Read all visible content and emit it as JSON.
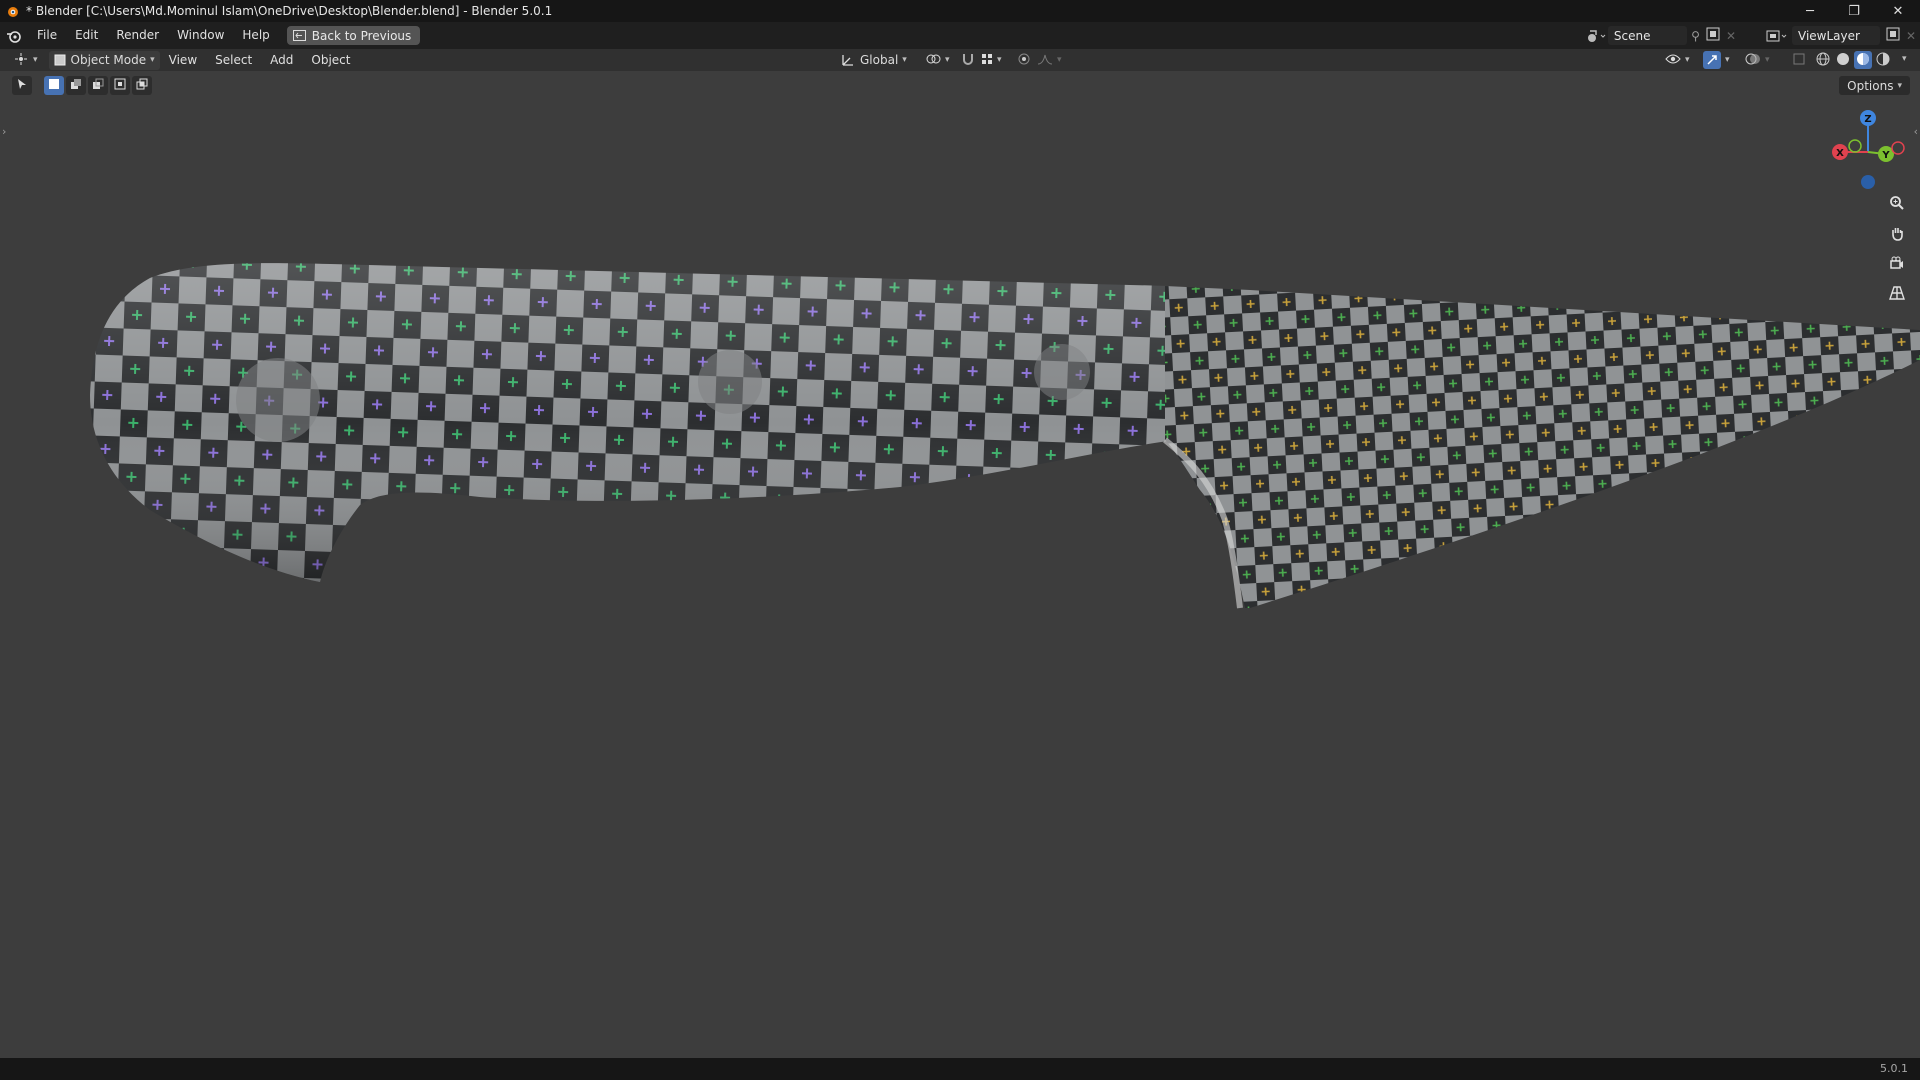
{
  "window": {
    "title": "* Blender [C:\\Users\\Md.Mominul Islam\\OneDrive\\Desktop\\Blender.blend] - Blender 5.0.1",
    "controls": [
      "─",
      "❐",
      "✕"
    ]
  },
  "menu": {
    "items": [
      "File",
      "Edit",
      "Render",
      "Window",
      "Help"
    ],
    "back_button": "Back to Previous"
  },
  "scene": {
    "label": "Scene"
  },
  "view_layer": {
    "label": "ViewLayer"
  },
  "viewport_header": {
    "mode": "Object Mode",
    "menus": [
      "View",
      "Select",
      "Add",
      "Object"
    ],
    "transform_orientation": "Global"
  },
  "viewport": {
    "options_label": "Options"
  },
  "gizmo": {
    "x": "X",
    "y": "Y",
    "z": "Z"
  },
  "status": {
    "version": "5.0.1"
  },
  "colors": {
    "accent": "#4772b3",
    "x_axis": "#e0424f",
    "y_axis": "#7cc02f",
    "z_axis": "#3f86e0",
    "background": "#3d3d3d"
  }
}
